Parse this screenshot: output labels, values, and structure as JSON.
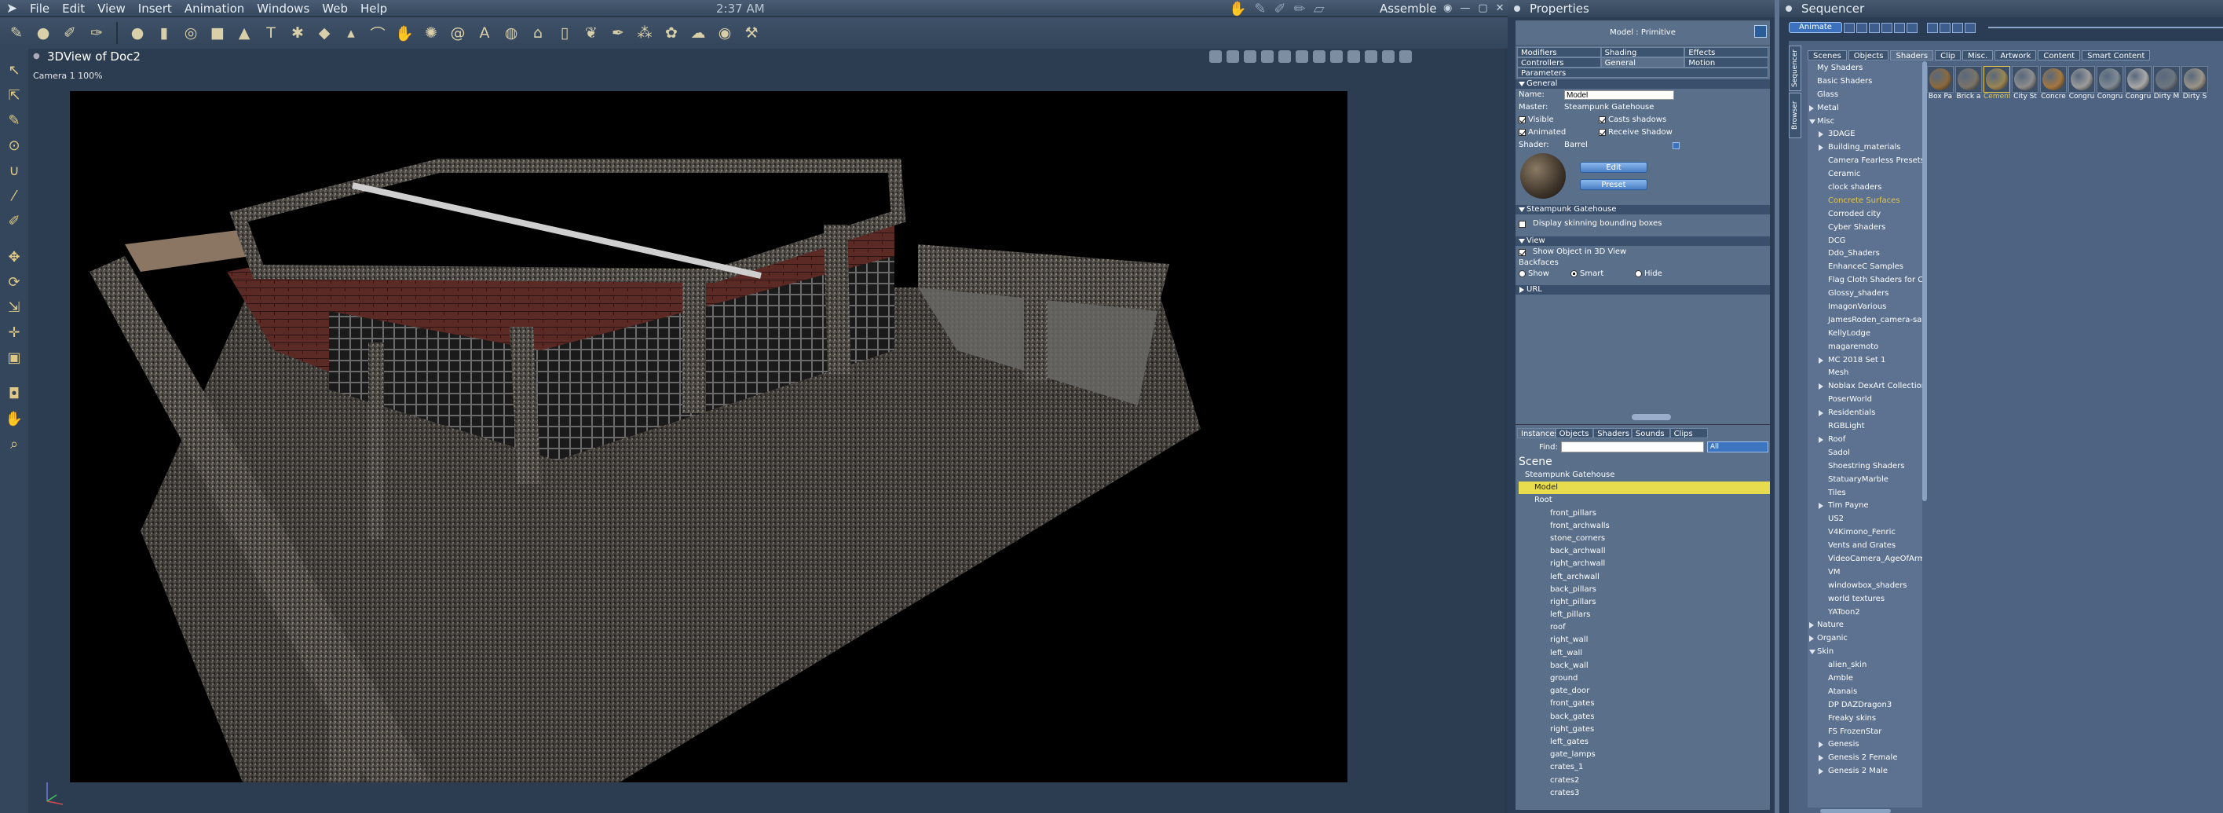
{
  "menu": {
    "items": [
      "File",
      "Edit",
      "View",
      "Insert",
      "Animation",
      "Windows",
      "Web",
      "Help"
    ],
    "time": "2:37 AM",
    "mode": "Assemble"
  },
  "viewport": {
    "title": "3DView of Doc2",
    "camera": "Camera 1 100%"
  },
  "properties": {
    "title": "Properties",
    "header": "Model : Primitive",
    "tabs": [
      "Modifiers",
      "Shading",
      "Effects",
      "Controllers",
      "General",
      "Motion",
      "Parameters"
    ],
    "general_section": "General",
    "name_label": "Name:",
    "name_value": "Model",
    "master_label": "Master:",
    "master_value": "Steampunk Gatehouse",
    "visible": "Visible",
    "casts_shadows": "Casts shadows",
    "animated": "Animated",
    "receive_shadow": "Receive Shadow",
    "shader_label": "Shader:",
    "shader_value": "Barrel",
    "edit_btn": "Edit",
    "preset_btn": "Preset",
    "sg_section": "Steampunk Gatehouse",
    "display_skinning": "Display skinning bounding boxes",
    "view_section": "View",
    "show_object": "Show Object in 3D View",
    "backfaces": "Backfaces",
    "show": "Show",
    "smart": "Smart",
    "hide": "Hide",
    "url_section": "URL"
  },
  "instances": {
    "tabs": [
      "Instances",
      "Objects",
      "Shaders",
      "Sounds",
      "Clips"
    ],
    "find_label": "Find:",
    "filter": "All",
    "scene": "Scene",
    "tree": [
      "Steampunk Gatehouse",
      "Model",
      "Root",
      "front_pillars",
      "front_archwalls",
      "stone_corners",
      "back_archwall",
      "right_archwall",
      "left_archwall",
      "back_pillars",
      "right_pillars",
      "left_pillars",
      "roof",
      "right_wall",
      "left_wall",
      "back_wall",
      "ground",
      "gate_door",
      "front_gates",
      "back_gates",
      "right_gates",
      "left_gates",
      "gate_lamps",
      "crates_1",
      "crates2",
      "crates3"
    ]
  },
  "sequencer": {
    "title": "Sequencer",
    "animate": "Animate",
    "side_tabs": [
      "Sequencer",
      "Browser"
    ],
    "tabs": [
      "Scenes",
      "Objects",
      "Shaders",
      "Clip",
      "Misc.",
      "Artwork",
      "Content",
      "Smart Content"
    ],
    "list": [
      "My Shaders",
      "Basic Shaders",
      "Glass",
      "Metal",
      "Misc",
      "3DAGE",
      "Building_materials",
      "Camera Fearless Presets",
      "Ceramic",
      "clock shaders",
      "Concrete Surfaces",
      "Corroded city",
      "Cyber Shaders",
      "DCG",
      "Ddo_Shaders",
      "EnhanceC Samples",
      "Flag Cloth Shaders for Car",
      "Glossy_shaders",
      "ImagonVarious",
      "JamesRoden_camera-satin",
      "KellyLodge",
      "magaremoto",
      "MC 2018 Set 1",
      "Mesh",
      "Noblax DexArt Collection",
      "PoserWorld",
      "Residentials",
      "RGBLight",
      "Roof",
      "Sadol",
      "Shoestring Shaders",
      "StatuaryMarble",
      "Tiles",
      "Tim Payne",
      "US2",
      "V4Kimono_Fenric",
      "Vents and Grates",
      "VideoCamera_AgeOfArmour",
      "VM",
      "windowbox_shaders",
      "world textures",
      "YAToon2",
      "Nature",
      "Organic",
      "Skin",
      "alien_skin",
      "Amble",
      "Atanais",
      "DP DAZDragon3",
      "Freaky skins",
      "FS FrozenStar",
      "Genesis",
      "Genesis 2 Female",
      "Genesis 2 Male"
    ],
    "thumbs": [
      "Box Pa",
      "Brick a",
      "Cement",
      "City St",
      "Concre",
      "Congru",
      "Congru",
      "Congru",
      "Dirty M",
      "Dirty S"
    ]
  }
}
